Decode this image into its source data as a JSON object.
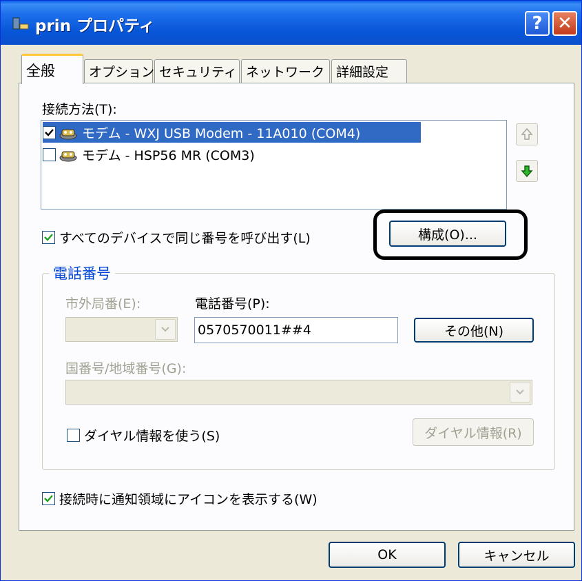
{
  "window": {
    "title": "prin プロパティ",
    "help_glyph": "?",
    "close_glyph": "✕"
  },
  "tabs": [
    {
      "label": "全般",
      "active": true
    },
    {
      "label": "オプション",
      "active": false
    },
    {
      "label": "セキュリティ",
      "active": false
    },
    {
      "label": "ネットワーク",
      "active": false
    },
    {
      "label": "詳細設定",
      "active": false
    }
  ],
  "connection": {
    "label": "接続方法(T):",
    "devices": [
      {
        "label": "モデム - WXJ USB Modem - 11A010 (COM4)",
        "checked": true,
        "selected": true
      },
      {
        "label": "モデム - HSP56 MR (COM3)",
        "checked": false,
        "selected": false
      }
    ]
  },
  "same_number_checkbox": {
    "label": "すべてのデバイスで同じ番号を呼び出す(L)",
    "checked": true
  },
  "configure_button": "構成(O)...",
  "phone_group": {
    "title": "電話番号",
    "area_code_label": "市外局番(E):",
    "phone_number_label": "電話番号(P):",
    "phone_number_value": "0570570011##4",
    "alternates_button": "その他(N)",
    "country_label": "国番号/地域番号(G):",
    "dialing_rules_checkbox": {
      "label": "ダイヤル情報を使う(S)",
      "checked": false
    },
    "dialing_rules_button": "ダイヤル情報(R)"
  },
  "notify_checkbox": {
    "label": "接続時に通知領域にアイコンを表示する(W)",
    "checked": true
  },
  "footer": {
    "ok_label": "OK",
    "cancel_label": "キャンセル"
  },
  "colors": {
    "titlebar": "#0756D8",
    "selection": "#316AC5",
    "group_title": "#0046D5",
    "dialog_bg": "#ECE9D8"
  }
}
